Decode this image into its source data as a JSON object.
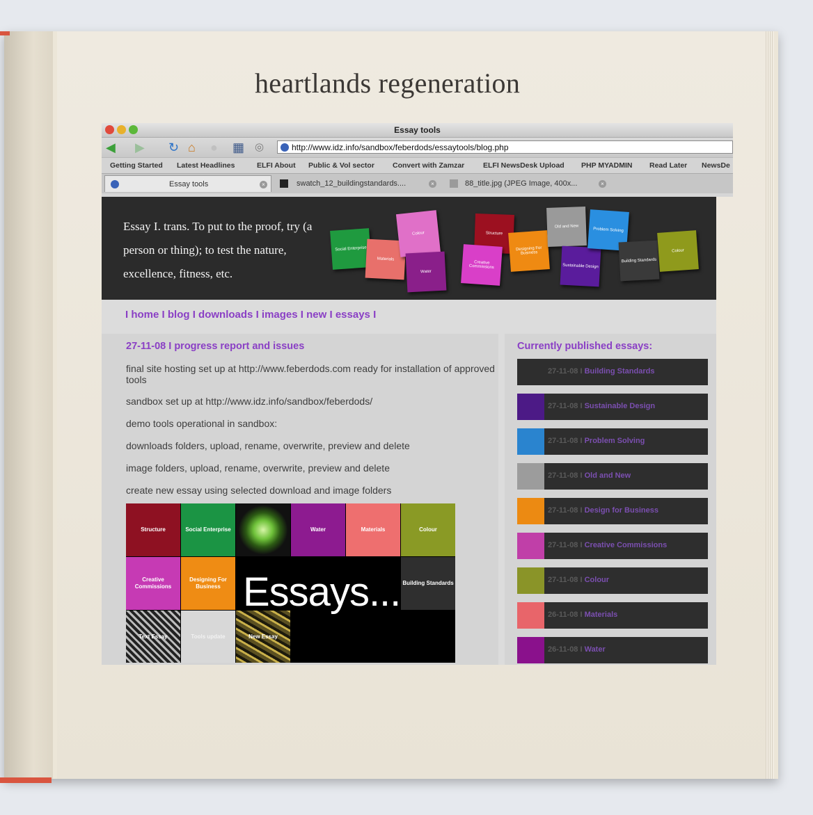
{
  "book": {
    "headline": "heartlands regeneration"
  },
  "browser": {
    "window_title": "Essay tools",
    "url": "http://www.idz.info/sandbox/feberdods/essaytools/blog.php",
    "bookmarks": [
      "Getting Started",
      "Latest Headlines",
      "ELFI About",
      "Public & Vol sector",
      "Convert with Zamzar",
      "ELFI NewsDesk Upload",
      "PHP MYADMIN",
      "Read Later",
      "NewsDe"
    ],
    "tabs": [
      "Essay tools",
      "swatch_12_buildingstandards....",
      "88_title.jpg (JPEG Image, 400x..."
    ]
  },
  "banner": {
    "tagline": "Essay  I. trans. To put to the proof, try (a person or thing); to test the nature, excellence, fitness, etc.",
    "squares": [
      {
        "label": "Social Enterprise",
        "color": "#1f9a3f"
      },
      {
        "label": "Materials",
        "color": "#e8706b"
      },
      {
        "label": "Colour",
        "color": "#e070c8"
      },
      {
        "label": "Water",
        "color": "#8a1f8a"
      },
      {
        "label": "Structure",
        "color": "#9c1020"
      },
      {
        "label": "Creative Commissions",
        "color": "#d93fc8"
      },
      {
        "label": "Designing For Business",
        "color": "#ef8a12"
      },
      {
        "label": "Old and New",
        "color": "#9a9a9a"
      },
      {
        "label": "Sustainable Design",
        "color": "#5a1c9c"
      },
      {
        "label": "Problem Solving",
        "color": "#2a8fe0"
      },
      {
        "label": "Building Standards",
        "color": "#3a3a3a"
      },
      {
        "label": "Colour",
        "color": "#8f9a1c"
      }
    ]
  },
  "nav": {
    "home": "home",
    "blog": "blog",
    "downloads": "downloads",
    "images": "images",
    "new": "new",
    "essays": "essays",
    "sep": "I"
  },
  "post": {
    "title": "27-11-08 I progress report and issues",
    "lines": [
      "final site hosting set up at http://www.feberdods.com ready for installation of approved tools",
      "sandbox set up at http://www.idz.info/sandbox/feberdods/",
      "demo tools operational in sandbox:",
      "downloads folders, upload, rename, overwrite, preview and delete",
      "image folders, upload, rename, overwrite, preview and delete",
      "create new essay using selected download and image folders"
    ]
  },
  "mosaic": {
    "essays_word": "Essays...",
    "tiles": [
      {
        "label": "Structure",
        "color": "#8e1122"
      },
      {
        "label": "Social Enterprise",
        "color": "#1b9444"
      },
      {
        "label": "",
        "color": "#111111"
      },
      {
        "label": "Water",
        "color": "#8d1b90"
      },
      {
        "label": "Materials",
        "color": "#ee6f6f"
      },
      {
        "label": "Colour",
        "color": "#8a9a25"
      },
      {
        "label": "Creative Commissions",
        "color": "#c63ab4"
      },
      {
        "label": "Designing For Business",
        "color": "#ef8c14"
      },
      {
        "label": "Building Standards",
        "color": "#2f2f2f"
      },
      {
        "label": "Text Essay",
        "color": "#3a3a3a"
      },
      {
        "label": "Tools update",
        "color": "#d8d8d8"
      },
      {
        "label": "New Essay",
        "color": "#5b5021"
      }
    ]
  },
  "sidebar": {
    "heading": "Currently published essays:",
    "essays": [
      {
        "date": "27-11-08 I ",
        "title": "Building Standards",
        "color": "#2e2e2e"
      },
      {
        "date": "27-11-08 I ",
        "title": "Sustainable Design",
        "color": "#4c1a86"
      },
      {
        "date": "27-11-08 I ",
        "title": "Problem Solving",
        "color": "#2a84cf"
      },
      {
        "date": "27-11-08 I ",
        "title": "Old and New",
        "color": "#9c9c9c"
      },
      {
        "date": "27-11-08 I ",
        "title": "Design for Business",
        "color": "#ec8a12"
      },
      {
        "date": "27-11-08 I ",
        "title": "Creative Commissions",
        "color": "#c03fa8"
      },
      {
        "date": "27-11-08 I ",
        "title": "Colour",
        "color": "#8a9428"
      },
      {
        "date": "26-11-08 I ",
        "title": "Materials",
        "color": "#e8656a"
      },
      {
        "date": "26-11-08 I ",
        "title": "Water",
        "color": "#8a118c"
      }
    ]
  }
}
